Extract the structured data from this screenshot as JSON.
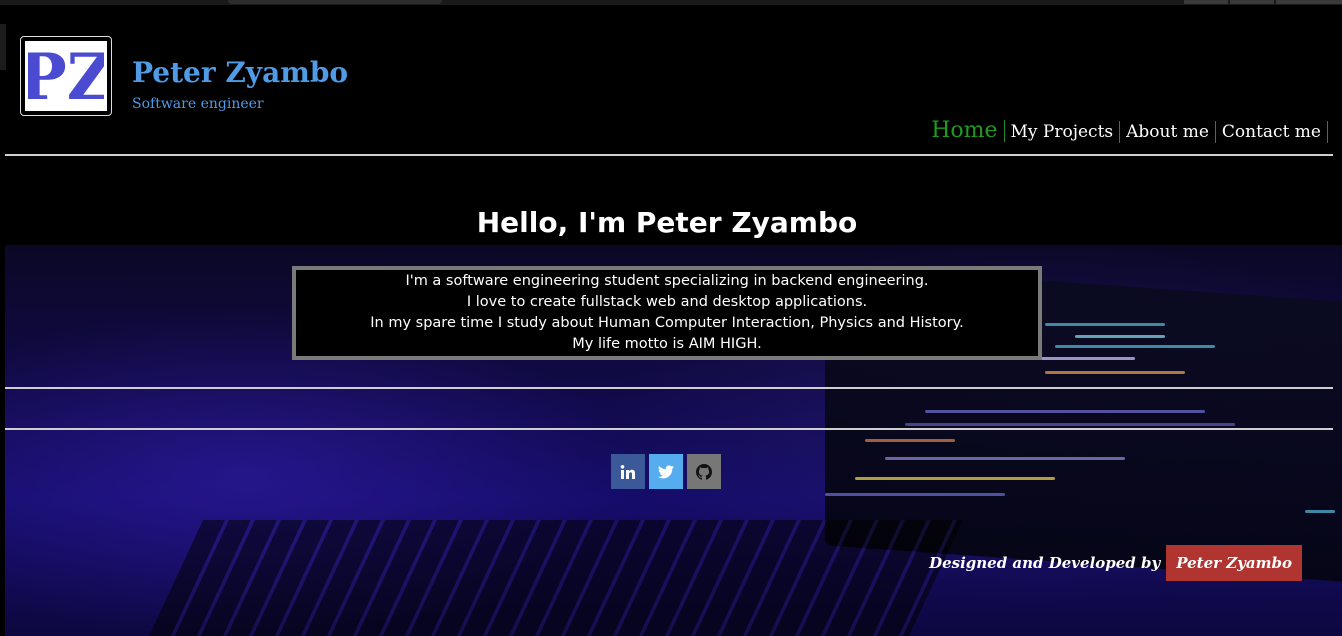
{
  "brand": {
    "logo_text": "PZ",
    "title": "Peter Zyambo",
    "subtitle": "Software engineer"
  },
  "nav": {
    "items": [
      {
        "label": "Home",
        "active": true
      },
      {
        "label": "My Projects",
        "active": false
      },
      {
        "label": "About me",
        "active": false
      },
      {
        "label": "Contact me",
        "active": false
      }
    ]
  },
  "hero": {
    "title": "Hello, I'm Peter Zyambo",
    "intro_lines": [
      "I'm a software engineering student specializing in backend engineering.",
      "I love to create fullstack web and desktop applications.",
      "In my spare time I study about Human Computer Interaction, Physics and History.",
      "My life motto is AIM HIGH."
    ]
  },
  "social": {
    "buttons": [
      {
        "icon": "linkedin-icon",
        "color": "#3b5998"
      },
      {
        "icon": "twitter-icon",
        "color": "#55acee"
      },
      {
        "icon": "github-icon",
        "color": "#777777"
      }
    ]
  },
  "footer": {
    "credit_label": "Designed and Developed by",
    "credit_name": "Peter Zyambo"
  },
  "colors": {
    "brand_blue": "#4f9be6",
    "nav_active": "#1f9a1f",
    "credit_red": "#b03530",
    "background": "#000000"
  }
}
